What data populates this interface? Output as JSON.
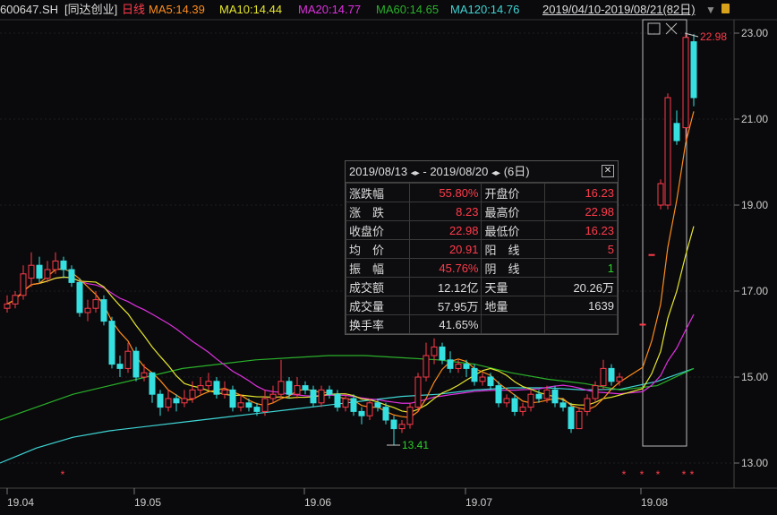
{
  "header": {
    "code": "600647.SH",
    "name": "[同达创业]",
    "period": "日线",
    "ma5": "MA5:14.39",
    "ma10": "MA10:14.44",
    "ma20": "MA20:14.77",
    "ma60": "MA60:14.65",
    "ma120": "MA120:14.76",
    "range": "2019/04/10-2019/08/21(82日)"
  },
  "colors": {
    "up": "#ff3b4a",
    "down": "#36e0e0",
    "ma5": "#ff8c1a",
    "ma10": "#e6e62e",
    "ma20": "#e030e0",
    "ma60": "#2ab02a",
    "ma120": "#3fd5d5"
  },
  "panel": {
    "date_from": "2019/08/13",
    "date_to": "2019/08/20",
    "days": "(6日)",
    "rows": [
      {
        "l1": "涨跌幅",
        "v1": "55.80%",
        "c1": "red",
        "l2": "开盘价",
        "v2": "16.23",
        "c2": "red"
      },
      {
        "l1": "涨　跌",
        "v1": "8.23",
        "c1": "red",
        "l2": "最高价",
        "v2": "22.98",
        "c2": "red"
      },
      {
        "l1": "收盘价",
        "v1": "22.98",
        "c1": "red",
        "l2": "最低价",
        "v2": "16.23",
        "c2": "red"
      },
      {
        "l1": "均　价",
        "v1": "20.91",
        "c1": "red",
        "l2": "阳　线",
        "v2": "5",
        "c2": "red"
      },
      {
        "l1": "振　幅",
        "v1": "45.76%",
        "c1": "red",
        "l2": "阴　线",
        "v2": "1",
        "c2": "grn"
      },
      {
        "l1": "成交额",
        "v1": "12.12亿",
        "c1": "",
        "l2": "天量",
        "v2": "20.26万",
        "c2": ""
      },
      {
        "l1": "成交量",
        "v1": "57.95万",
        "c1": "",
        "l2": "地量",
        "v2": "1639",
        "c2": ""
      },
      {
        "l1": "换手率",
        "v1": "41.65%",
        "c1": "",
        "l2": "",
        "v2": "",
        "c2": ""
      }
    ]
  },
  "chart_data": {
    "type": "candlestick",
    "ylim": [
      12.9,
      23.4
    ],
    "yticks": [
      "13.00",
      "15.00",
      "17.00",
      "19.00",
      "21.00",
      "23.00"
    ],
    "xticks": [
      "19.04",
      "19.05",
      "19.06",
      "19.07",
      "19.08"
    ],
    "annotations": {
      "high": "22.98",
      "low": "13.41"
    },
    "candles": [
      [
        16.6,
        16.9,
        16.5,
        16.7
      ],
      [
        16.7,
        17.0,
        16.6,
        16.9
      ],
      [
        16.9,
        17.6,
        16.8,
        17.4
      ],
      [
        17.3,
        17.9,
        17.1,
        17.6
      ],
      [
        17.6,
        17.8,
        17.2,
        17.3
      ],
      [
        17.3,
        17.7,
        17.2,
        17.5
      ],
      [
        17.5,
        17.9,
        17.4,
        17.7
      ],
      [
        17.7,
        17.8,
        17.3,
        17.5
      ],
      [
        17.5,
        17.6,
        17.1,
        17.2
      ],
      [
        17.2,
        17.3,
        16.4,
        16.5
      ],
      [
        16.5,
        16.8,
        16.3,
        16.6
      ],
      [
        16.6,
        17.0,
        16.5,
        16.8
      ],
      [
        16.8,
        16.9,
        16.2,
        16.3
      ],
      [
        16.3,
        16.4,
        15.2,
        15.3
      ],
      [
        15.3,
        15.5,
        15.0,
        15.2
      ],
      [
        15.2,
        15.8,
        15.1,
        15.6
      ],
      [
        15.6,
        15.7,
        14.9,
        15.0
      ],
      [
        15.0,
        15.3,
        14.9,
        15.1
      ],
      [
        15.1,
        15.1,
        14.4,
        14.6
      ],
      [
        14.6,
        14.7,
        14.1,
        14.3
      ],
      [
        14.3,
        14.7,
        14.2,
        14.5
      ],
      [
        14.5,
        14.6,
        14.2,
        14.4
      ],
      [
        14.4,
        14.7,
        14.3,
        14.5
      ],
      [
        14.5,
        14.9,
        14.4,
        14.7
      ],
      [
        14.7,
        15.0,
        14.6,
        14.8
      ],
      [
        14.8,
        15.1,
        14.7,
        14.9
      ],
      [
        14.9,
        15.0,
        14.5,
        14.6
      ],
      [
        14.6,
        14.9,
        14.5,
        14.7
      ],
      [
        14.7,
        14.8,
        14.2,
        14.3
      ],
      [
        14.3,
        14.6,
        14.2,
        14.4
      ],
      [
        14.4,
        14.5,
        14.2,
        14.3
      ],
      [
        14.3,
        14.4,
        14.1,
        14.2
      ],
      [
        14.2,
        14.7,
        14.1,
        14.5
      ],
      [
        14.5,
        14.8,
        14.4,
        14.6
      ],
      [
        14.6,
        15.4,
        14.5,
        14.9
      ],
      [
        14.9,
        15.0,
        14.5,
        14.6
      ],
      [
        14.6,
        15.0,
        14.5,
        14.8
      ],
      [
        14.8,
        14.9,
        14.6,
        14.7
      ],
      [
        14.7,
        14.8,
        14.3,
        14.4
      ],
      [
        14.4,
        14.8,
        14.3,
        14.7
      ],
      [
        14.7,
        14.8,
        14.5,
        14.6
      ],
      [
        14.6,
        14.7,
        14.2,
        14.3
      ],
      [
        14.3,
        14.6,
        14.2,
        14.5
      ],
      [
        14.5,
        14.6,
        14.1,
        14.2
      ],
      [
        14.2,
        14.3,
        13.9,
        14.1
      ],
      [
        14.1,
        14.5,
        14.0,
        14.4
      ],
      [
        14.4,
        14.5,
        14.2,
        14.3
      ],
      [
        14.3,
        14.4,
        13.9,
        14.0
      ],
      [
        14.0,
        14.1,
        13.41,
        13.8
      ],
      [
        13.8,
        14.0,
        13.7,
        13.9
      ],
      [
        13.9,
        14.4,
        13.8,
        14.3
      ],
      [
        14.3,
        15.1,
        14.2,
        15.0
      ],
      [
        15.0,
        15.8,
        14.9,
        15.5
      ],
      [
        15.5,
        15.9,
        15.3,
        15.7
      ],
      [
        15.7,
        15.8,
        15.3,
        15.4
      ],
      [
        15.4,
        15.6,
        15.1,
        15.2
      ],
      [
        15.2,
        15.4,
        15.1,
        15.3
      ],
      [
        15.3,
        15.4,
        15.0,
        15.2
      ],
      [
        15.2,
        15.3,
        14.8,
        14.9
      ],
      [
        14.9,
        15.1,
        14.8,
        15.0
      ],
      [
        15.0,
        15.1,
        14.7,
        14.8
      ],
      [
        14.8,
        14.9,
        14.3,
        14.4
      ],
      [
        14.4,
        14.6,
        14.3,
        14.5
      ],
      [
        14.5,
        14.6,
        14.1,
        14.2
      ],
      [
        14.2,
        14.4,
        14.1,
        14.3
      ],
      [
        14.3,
        14.7,
        14.2,
        14.6
      ],
      [
        14.6,
        14.7,
        14.4,
        14.5
      ],
      [
        14.5,
        14.8,
        14.4,
        14.7
      ],
      [
        14.7,
        14.8,
        14.3,
        14.4
      ],
      [
        14.4,
        14.5,
        14.2,
        14.3
      ],
      [
        14.3,
        14.4,
        13.7,
        13.8
      ],
      [
        13.8,
        14.3,
        13.8,
        14.2
      ],
      [
        14.2,
        14.6,
        14.1,
        14.5
      ],
      [
        14.5,
        14.9,
        14.4,
        14.8
      ],
      [
        14.8,
        15.4,
        14.7,
        15.2
      ],
      [
        15.2,
        15.3,
        14.8,
        14.9
      ],
      [
        14.9,
        15.1,
        14.8,
        15.0
      ],
      [
        16.23,
        16.23,
        16.23,
        16.23
      ],
      [
        17.85,
        17.85,
        17.85,
        17.85
      ],
      [
        19.0,
        19.6,
        18.9,
        19.5
      ],
      [
        19.0,
        21.6,
        18.9,
        21.5
      ],
      [
        20.9,
        21.2,
        20.4,
        20.5
      ],
      [
        20.8,
        22.98,
        20.5,
        22.9
      ],
      [
        22.8,
        22.98,
        21.3,
        21.5
      ]
    ],
    "ma60": [
      14.0,
      14.3,
      14.6,
      14.8,
      15.0,
      15.2,
      15.3,
      15.4,
      15.45,
      15.5,
      15.5,
      15.45,
      15.4,
      15.3,
      15.1,
      14.95,
      14.85,
      14.7,
      14.8,
      15.2
    ],
    "ma120": [
      13.0,
      13.35,
      13.6,
      13.75,
      13.85,
      13.95,
      14.05,
      14.15,
      14.25,
      14.35,
      14.45,
      14.55,
      14.6,
      14.7,
      14.75,
      14.75,
      14.7,
      14.72,
      14.9,
      15.2
    ]
  }
}
